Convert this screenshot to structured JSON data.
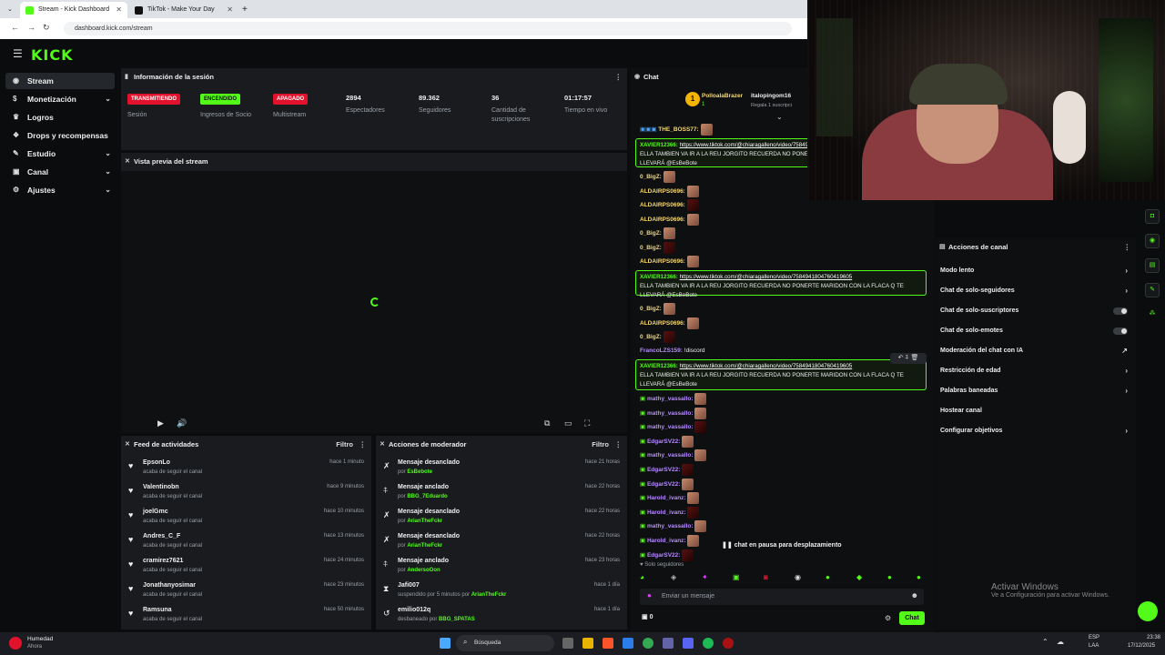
{
  "browser": {
    "tabs": [
      {
        "title": "Stream - Kick Dashboard",
        "active": true
      },
      {
        "title": "TikTok - Make Your Day",
        "active": false
      }
    ],
    "url": "dashboard.kick.com/stream"
  },
  "app": {
    "logo": "KICK",
    "sidebar": [
      {
        "label": "Stream",
        "icon": "broadcast-icon",
        "active": true,
        "chevron": false
      },
      {
        "label": "Monetización",
        "icon": "dollar-icon",
        "chevron": true
      },
      {
        "label": "Logros",
        "icon": "trophy-icon",
        "chevron": false
      },
      {
        "label": "Drops y recompensas",
        "icon": "gift-icon",
        "chevron": false
      },
      {
        "label": "Estudio",
        "icon": "brush-icon",
        "chevron": true
      },
      {
        "label": "Canal",
        "icon": "folder-icon",
        "chevron": true
      },
      {
        "label": "Ajustes",
        "icon": "gear-icon",
        "chevron": true
      }
    ]
  },
  "session": {
    "title": "Información de la sesión",
    "stats": [
      {
        "badge": "TRANSMITIENDO",
        "badge_color": "#e3122c",
        "label": "Sesión"
      },
      {
        "badge": "ENCENDIDO",
        "badge_color": "#53fc18",
        "label": "Ingresos de Socio"
      },
      {
        "badge": "APAGADO",
        "badge_color": "#e3122c",
        "label": "Multistream"
      },
      {
        "value": "2894",
        "label": "Espectadores"
      },
      {
        "value": "89.362",
        "label": "Seguidores"
      },
      {
        "value": "36",
        "label": "Cantidad de suscripciones"
      },
      {
        "value": "01:17:57",
        "label": "Tiempo en vivo"
      }
    ]
  },
  "preview": {
    "title": "Vista previa del stream"
  },
  "activity": {
    "title": "Feed de actividades",
    "filter": "Filtro",
    "rows": [
      {
        "name": "EpsonLo",
        "sub": "acaba de seguir el canal",
        "time": "hace 1 minuto"
      },
      {
        "name": "Valentinobn",
        "sub": "acaba de seguir el canal",
        "time": "hace 9 minutos"
      },
      {
        "name": "joelGmc",
        "sub": "acaba de seguir el canal",
        "time": "hace 10 minutos"
      },
      {
        "name": "Andres_C_F",
        "sub": "acaba de seguir el canal",
        "time": "hace 13 minutos"
      },
      {
        "name": "cramirez7621",
        "sub": "acaba de seguir el canal",
        "time": "hace 24 minutos"
      },
      {
        "name": "Jonathanyosimar",
        "sub": "acaba de seguir el canal",
        "time": "hace 23 minutos"
      },
      {
        "name": "Ramsuna",
        "sub": "acaba de seguir el canal",
        "time": "hace 50 minutos"
      }
    ]
  },
  "modactions": {
    "title": "Acciones de moderador",
    "filter": "Filtro",
    "rows": [
      {
        "name": "Mensaje desanclado",
        "pre": "por ",
        "by": "EsBebote",
        "time": "hace 21 horas",
        "icon": "unpin-icon"
      },
      {
        "name": "Mensaje anclado",
        "pre": "por ",
        "by": "BBG_7Eduardo",
        "time": "hace 22 horas",
        "icon": "pin-icon"
      },
      {
        "name": "Mensaje desanclado",
        "pre": "por ",
        "by": "ArianTheFckr",
        "time": "hace 22 horas",
        "icon": "unpin-icon"
      },
      {
        "name": "Mensaje desanclado",
        "pre": "por ",
        "by": "ArianTheFckr",
        "time": "hace 22 horas",
        "icon": "unpin-icon"
      },
      {
        "name": "Mensaje anclado",
        "pre": "por ",
        "by": "AndersoOon",
        "time": "hace 23 horas",
        "icon": "pin-icon"
      },
      {
        "name": "Jafi007",
        "pre": "suspendido por 5 minutos por ",
        "by": "ArianTheFckr",
        "time": "hace 1 día",
        "icon": "hourglass-icon"
      },
      {
        "name": "emilio012q",
        "pre": "desbaneado por ",
        "by": "BBG_SPATAS",
        "time": "hace 1 día",
        "icon": "undo-icon"
      }
    ]
  },
  "chat": {
    "title": "Chat",
    "gifter": "PolloalaBrazer",
    "gifter_count": "1",
    "gift_user": "italopingom16",
    "gift_sub": "Regala 1 suscripci",
    "top_user": "THE_BOSS77:",
    "pinned_user": "XAVIER12366:",
    "pinned_link": "https://www.tiktok.com/@chiaragalleno/video/7584941804760419605",
    "pinned_text": "ELLA TAMBIEN VA IR A LA REU JORGITO RECUERDA NO PONERTE MARIDON CON LA FLACA Q TE LLEVARÁ @EsBeBote",
    "messages": [
      {
        "user": "0_BigZ:",
        "color": "#f5d76e"
      },
      {
        "user": "ALDAIRPS0696:",
        "color": "#f5d76e"
      },
      {
        "user": "ALDAIRPS0696:",
        "color": "#f5d76e"
      },
      {
        "user": "ALDAIRPS0696:",
        "color": "#f5d76e"
      },
      {
        "user": "0_BigZ:",
        "color": "#f5d76e"
      },
      {
        "user": "0_BigZ:",
        "color": "#f5d76e"
      },
      {
        "user": "ALDAIRPS0696:",
        "color": "#f5d76e"
      }
    ],
    "messages2": [
      {
        "user": "0_BigZ:",
        "color": "#f5d76e"
      },
      {
        "user": "ALDAIRPS0696:",
        "color": "#f5d76e"
      },
      {
        "user": "0_BigZ:",
        "color": "#f5d76e"
      },
      {
        "user": "FrancoLZS159:",
        "color": "#b68cff",
        "text": " !discord"
      }
    ],
    "messages3": [
      {
        "user": "mathy_vassallo:",
        "color": "#b68cff"
      },
      {
        "user": "mathy_vassallo:",
        "color": "#b68cff"
      },
      {
        "user": "mathy_vassallo:",
        "color": "#b68cff"
      },
      {
        "user": "EdgarSV22:",
        "color": "#b68cff"
      },
      {
        "user": "mathy_vassallo:",
        "color": "#b68cff"
      },
      {
        "user": "EdgarSV22:",
        "color": "#b68cff"
      },
      {
        "user": "EdgarSV22:",
        "color": "#b68cff"
      },
      {
        "user": "Harold_ivanz:",
        "color": "#b68cff"
      },
      {
        "user": "Harold_ivanz:",
        "color": "#b68cff"
      },
      {
        "user": "mathy_vassallo:",
        "color": "#b68cff"
      },
      {
        "user": "Harold_ivanz:",
        "color": "#b68cff"
      },
      {
        "user": "EdgarSV22:",
        "color": "#b68cff"
      }
    ],
    "paused": "chat en pausa para desplazamiento",
    "mode": "Solo seguidores",
    "input_placeholder": "Enviar un mensaje",
    "viewers_small": "0",
    "send_label": "Chat"
  },
  "canal": {
    "title": "Acciones de canal",
    "rows": [
      {
        "label": "Modo lento",
        "control": "chevron"
      },
      {
        "label": "Chat de solo-seguidores",
        "control": "chevron"
      },
      {
        "label": "Chat de solo-suscriptores",
        "control": "toggle"
      },
      {
        "label": "Chat de solo-emotes",
        "control": "toggle"
      },
      {
        "label": "Moderación del chat con IA",
        "control": "external"
      },
      {
        "label": "Restricción de edad",
        "control": "chevron"
      },
      {
        "label": "Palabras baneadas",
        "control": "chevron"
      },
      {
        "label": "Hostear canal",
        "control": "none"
      },
      {
        "label": "Configurar objetivos",
        "control": "chevron"
      }
    ]
  },
  "watermark": {
    "line1": "Activar Windows",
    "line2": "Ve a Configuración para activar Windows."
  },
  "taskbar": {
    "weather": "Humedad",
    "weather_sub": "Ahora",
    "search": "Búsqueda",
    "lang": "ESP",
    "lang2": "LAA",
    "time": "23:38",
    "date": "17/12/2025"
  }
}
